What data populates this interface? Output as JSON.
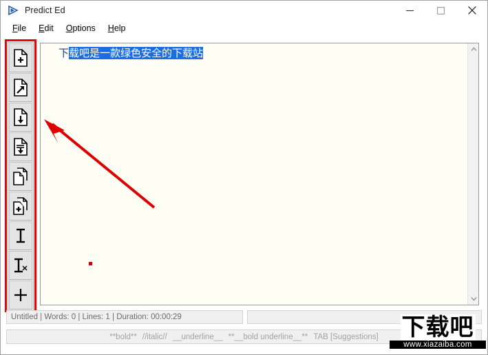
{
  "window": {
    "title": "Predict Ed",
    "app_icon": "play-triangle-icon",
    "controls": {
      "minimize": "minimize-icon",
      "maximize": "maximize-icon",
      "close": "close-icon"
    }
  },
  "menubar": {
    "items": [
      {
        "label": "File",
        "accel": "F"
      },
      {
        "label": "Edit",
        "accel": "E"
      },
      {
        "label": "Options",
        "accel": "O"
      },
      {
        "label": "Help",
        "accel": "H"
      }
    ]
  },
  "toolbar": {
    "buttons": [
      {
        "name": "new-document-button",
        "icon": "document-plus-icon",
        "tooltip": "New"
      },
      {
        "name": "open-document-button",
        "icon": "document-arrow-icon",
        "tooltip": "Open"
      },
      {
        "name": "save-document-button",
        "icon": "document-download-icon",
        "tooltip": "Save"
      },
      {
        "name": "save-as-document-button",
        "icon": "document-lines-download-icon",
        "tooltip": "Save As"
      },
      {
        "name": "copy-document-button",
        "icon": "copy-documents-icon",
        "tooltip": "Copy"
      },
      {
        "name": "add-document-button",
        "icon": "documents-plus-icon",
        "tooltip": "Add"
      },
      {
        "name": "text-cursor-button",
        "icon": "text-caret-icon",
        "tooltip": "Text"
      },
      {
        "name": "clear-text-button",
        "icon": "text-caret-delete-icon",
        "tooltip": "Clear Text"
      },
      {
        "name": "add-button",
        "icon": "plus-icon",
        "tooltip": "Add"
      }
    ]
  },
  "editor": {
    "unselected_text": "下",
    "selected_text": "载吧是一款绿色安全的下载站",
    "full_text": "下载吧是一款绿色安全的下载站",
    "scrollbar": {
      "up_arrow": "chevron-up-icon",
      "down_arrow": "chevron-down-icon"
    }
  },
  "annotations": {
    "rectangle_color": "#ee0000",
    "arrow_color": "#dd0000",
    "dot_color": "#d40000"
  },
  "status": {
    "left_text": "Untitled | Words: 0 | Lines: 1 | Duration: 00:00:29",
    "right_text": ""
  },
  "hints": {
    "bold": "**bold**",
    "italic": "//italic//",
    "underline": "__underline__",
    "bold_underline": "**__bold underline__**",
    "suggestions": "TAB [Suggestions]"
  },
  "watermark": {
    "logo_text": "下载吧",
    "url": "www.xiazaiba.com"
  },
  "colors": {
    "selection_bg": "#1c6ee0",
    "text_blue": "#1c3f94",
    "editor_bg": "#fffef4",
    "chrome_bg": "#f0f0f0"
  }
}
